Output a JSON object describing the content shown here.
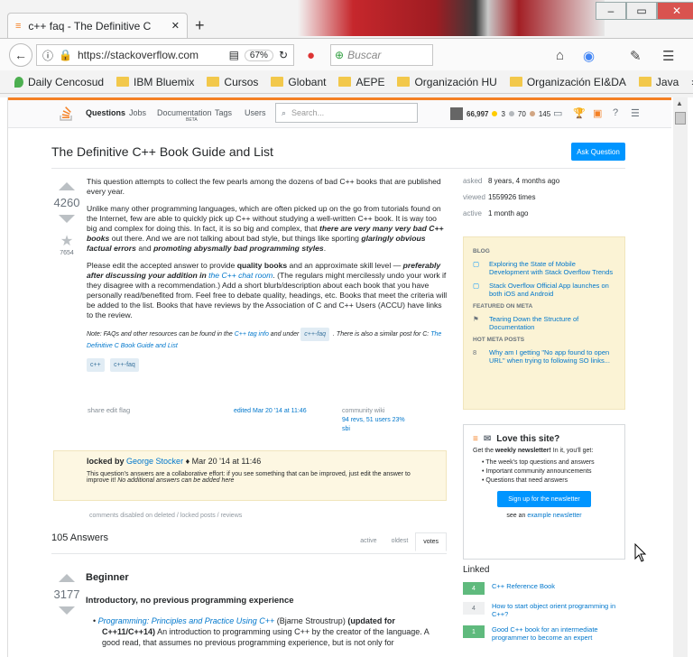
{
  "browser": {
    "tab_title": "c++ faq - The Definitive C",
    "new_tab": "+",
    "url": "https://stackoverflow.com",
    "zoom": "67%",
    "search_placeholder": "Buscar",
    "bookmarks": [
      "Daily Cencosud",
      "IBM Bluemix",
      "Cursos",
      "Globant",
      "AEPE",
      "Organización HU",
      "Organización EI&DA",
      "Java"
    ],
    "more": "»"
  },
  "so": {
    "nav": [
      "Questions",
      "Jobs",
      "Documentation",
      "Tags",
      "Users"
    ],
    "nav_beta": "BETA",
    "search_placeholder": "Search...",
    "reputation": "66,997",
    "badges": {
      "gold": "3",
      "silver": "70",
      "bronze": "145"
    }
  },
  "question": {
    "title": "The Definitive C++ Book Guide and List",
    "ask_button": "Ask Question",
    "votes": "4260",
    "favorites": "7654",
    "p1": "This question attempts to collect the few pearls among the dozens of bad C++ books that are published every year.",
    "p2a": "Unlike many other programming languages, which are often picked up on the go from tutorials found on the Internet, few are able to quickly pick up C++ without studying a well-written C++ book. It is way too big and complex for doing this. In fact, it is so big and complex, that",
    "p2b": "there are very many very bad C++ books",
    "p2c": "out there. And we are not talking about bad style, but things like sporting",
    "p2d": "glaringly obvious factual errors",
    "p2e": "and",
    "p2f": "promoting abysmally bad programming styles",
    "p3a": "Please edit the accepted answer to provide",
    "p3b": "quality books",
    "p3c": "and an approximate skill level —",
    "p3d": "preferably after discussing your addition in",
    "p3e": "the C++ chat room",
    "p3f": ". (The regulars might mercilessly undo your work if they disagree with a recommendation.) Add a short blurb/description about each book that you have personally read/benefited from. Feel free to debate quality, headings, etc. Books that meet the criteria will be added to the list. Books that have reviews by the Association of C and C++ Users (ACCU) have links to the review.",
    "note_a": "Note: FAQs and other resources can be found in the",
    "note_b": "C++ tag info",
    "note_c": "and under",
    "note_d": "c++-faq",
    "note_e": ". There is also a similar post for C:",
    "note_f": "The Definitive C Book Guide and List",
    "tags": [
      "c++",
      "c++-faq"
    ],
    "actions": "share edit flag",
    "edited": "edited Mar 20 '14 at 11:46",
    "wiki": "community wiki",
    "wiki_stats": "94 revs, 51 users 23%",
    "wiki_user": "sbi",
    "locked_by": "locked by",
    "locked_user": "George Stocker",
    "locked_date": "Mar 20 '14 at 11:46",
    "locked_text": "This question's answers are a collaborative effort: if you see something that can be improved, just edit the answer to improve it!",
    "locked_text2": "No additional answers can be added here",
    "comments_disabled": "comments disabled on deleted / locked posts / reviews"
  },
  "answers": {
    "count": "105 Answers",
    "tabs": [
      "active",
      "oldest",
      "votes"
    ],
    "votes": "3177",
    "h1": "Beginner",
    "h2": "Introductory, no previous programming experience",
    "book_title": "Programming: Principles and Practice Using C++",
    "book_author": "(Bjarne Stroustrup)",
    "book_updated": "(updated for C++11/C++14)",
    "book_desc": "An introduction to programming using C++ by the creator of the language. A good read, that assumes no previous programming experience, but is not only for"
  },
  "sidebar": {
    "stats": [
      {
        "k": "asked",
        "v": "8 years, 4 months ago"
      },
      {
        "k": "viewed",
        "v": "1559926 times"
      },
      {
        "k": "active",
        "v": "1 month ago"
      }
    ],
    "blog_hdr": "BLOG",
    "blog": [
      "Exploring the State of Mobile Development with Stack Overflow Trends",
      "Stack Overflow Official App launches on both iOS and Android"
    ],
    "meta_hdr": "FEATURED ON META",
    "meta": [
      "Tearing Down the Structure of Documentation"
    ],
    "hot_hdr": "HOT META POSTS",
    "hot_count": "8",
    "hot": [
      "Why am I getting \"No app found to open URL\" when trying to following SO links..."
    ],
    "nl_title": "Love this site?",
    "nl_sub_a": "Get the",
    "nl_sub_b": "weekly newsletter!",
    "nl_sub_c": "In it, you'll get:",
    "nl_items": [
      "The week's top questions and answers",
      "Important community announcements",
      "Questions that need answers"
    ],
    "nl_button": "Sign up for the newsletter",
    "nl_see": "see an",
    "nl_example": "example newsletter",
    "linked_hdr": "Linked",
    "linked": [
      {
        "count": "4",
        "title": "C++ Reference Book",
        "green": true
      },
      {
        "count": "4",
        "title": "How to start object orient programming in C++?",
        "green": false
      },
      {
        "count": "1",
        "title": "Good C++ book for an intermediate programmer to become an expert",
        "green": true
      }
    ]
  },
  "colors": {
    "accent": "#f48024",
    "link": "#0077cc",
    "button": "#0095ff",
    "locked_bg": "#fdf7e2"
  }
}
